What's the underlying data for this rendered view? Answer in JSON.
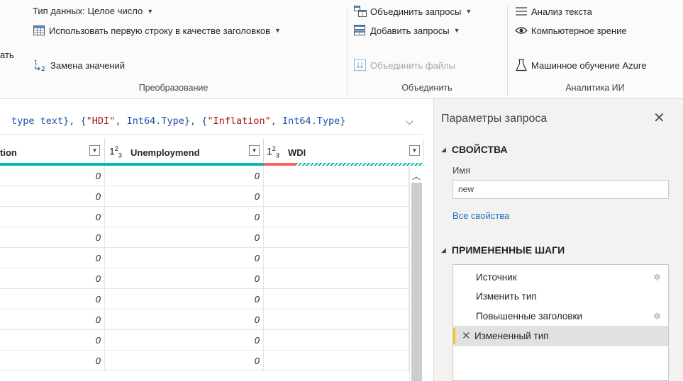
{
  "ribbon": {
    "truncated_left_label": "ать",
    "data_type": "Тип данных: Целое число",
    "use_first_row": "Использовать первую строку в качестве заголовков",
    "replace_values": "Замена значений",
    "merge_queries": "Объединить запросы",
    "append_queries": "Добавить запросы",
    "combine_files": "Объединить файлы",
    "text_analytics": "Анализ текста",
    "vision": "Компьютерное зрение",
    "azure_ml": "Машинное обучение Azure",
    "group_transform": "Преобразование",
    "group_combine": "Объединить",
    "group_ai": "Аналитика ИИ"
  },
  "formula": {
    "p1": " type text}, {",
    "s1": "\"HDI\"",
    "p2": ", Int64.Type}, {",
    "s2": "\"Inflation\"",
    "p3": ", Int64.Type}"
  },
  "grid": {
    "columns": [
      {
        "label": "tion",
        "type_icon": ""
      },
      {
        "label": "Unemploymend",
        "type_icon": "123"
      },
      {
        "label": "WDI",
        "type_icon": "123"
      }
    ],
    "rows": [
      [
        "0",
        "0",
        ""
      ],
      [
        "0",
        "0",
        ""
      ],
      [
        "0",
        "0",
        ""
      ],
      [
        "0",
        "0",
        ""
      ],
      [
        "0",
        "0",
        ""
      ],
      [
        "0",
        "0",
        ""
      ],
      [
        "0",
        "0",
        ""
      ],
      [
        "0",
        "0",
        ""
      ],
      [
        "0",
        "0",
        ""
      ],
      [
        "0",
        "0",
        ""
      ]
    ]
  },
  "pane": {
    "title": "Параметры запроса",
    "properties_header": "СВОЙСТВА",
    "name_label": "Имя",
    "name_value": "new",
    "all_properties": "Все свойства",
    "steps_header": "ПРИМЕНЕННЫЕ ШАГИ",
    "steps": [
      {
        "label": "Источник",
        "has_gear": true,
        "selected": false
      },
      {
        "label": "Изменить тип",
        "has_gear": false,
        "selected": false
      },
      {
        "label": "Повышенные заголовки",
        "has_gear": true,
        "selected": false
      },
      {
        "label": "Измененный тип",
        "has_gear": false,
        "selected": true
      }
    ]
  },
  "colors": {
    "accent_teal": "#01b8aa",
    "error_red": "#fd625e",
    "selected_step_marker": "#f2c811",
    "link_blue": "#1f6fc5"
  }
}
